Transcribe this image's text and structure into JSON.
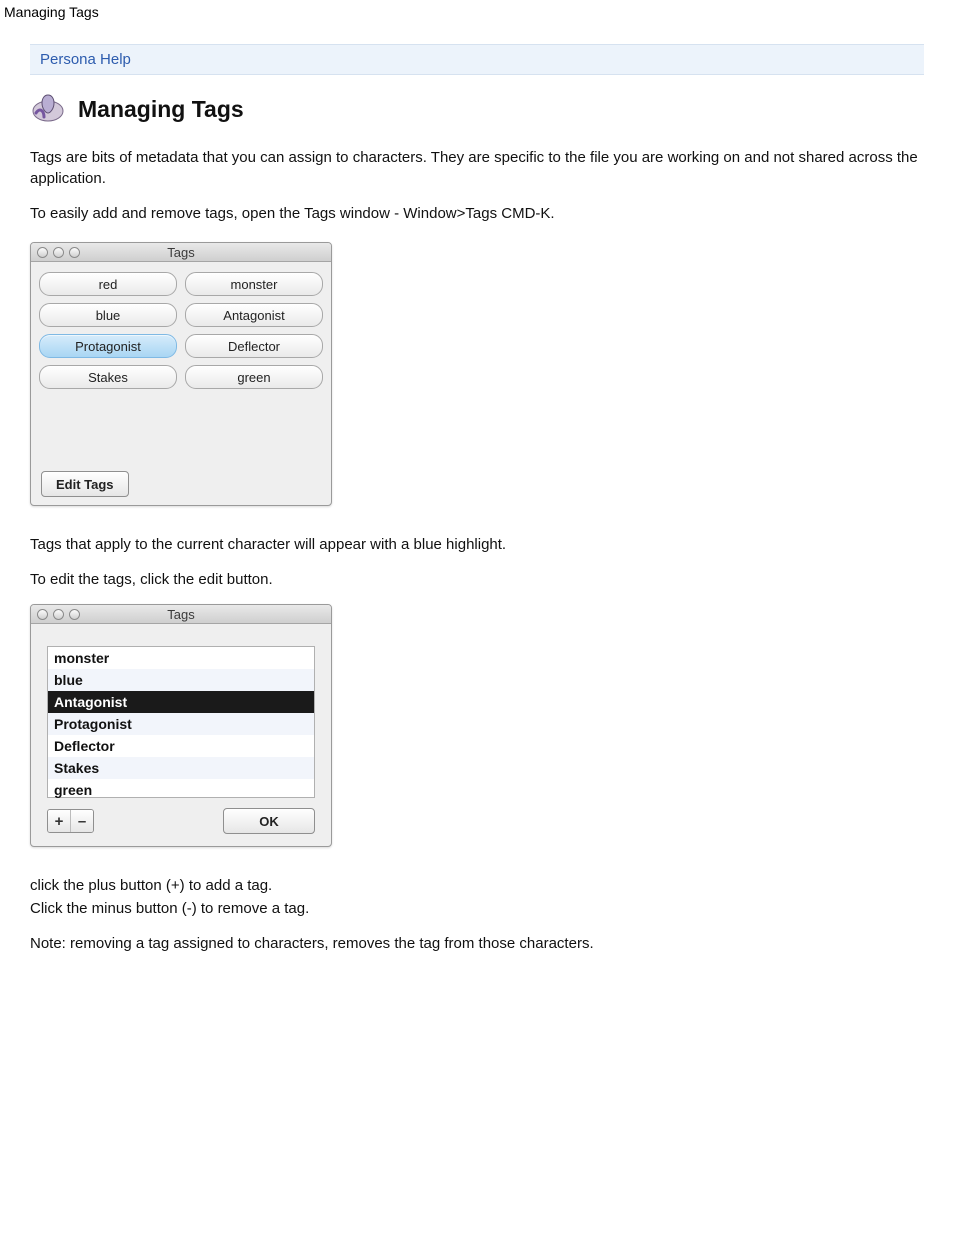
{
  "pageLabel": "Managing Tags",
  "breadcrumb": {
    "label": "Persona Help"
  },
  "title": "Managing Tags",
  "paragraphs": {
    "p1": "Tags are bits of metadata that you can assign to characters. They are specific to the file you are working on and not shared across the application.",
    "p2": "To easily add and remove tags, open the Tags window - Window>Tags CMD-K.",
    "p3": "Tags that apply to the current character will appear with a blue highlight.",
    "p4": "To edit the tags, click the edit button.",
    "p5": "click the plus button (+) to add a tag.",
    "p6": "Click the minus button (-) to remove a tag.",
    "p7": "Note: removing a tag assigned to characters, removes the tag from those characters."
  },
  "tagsWindow": {
    "title": "Tags",
    "pills": [
      {
        "label": "red",
        "selected": false
      },
      {
        "label": "monster",
        "selected": false
      },
      {
        "label": "blue",
        "selected": false
      },
      {
        "label": "Antagonist",
        "selected": false
      },
      {
        "label": "Protagonist",
        "selected": true
      },
      {
        "label": "Deflector",
        "selected": false
      },
      {
        "label": "Stakes",
        "selected": false
      },
      {
        "label": "green",
        "selected": false
      }
    ],
    "editBtn": "Edit Tags"
  },
  "editWindow": {
    "title": "Tags",
    "rows": [
      {
        "label": "monster",
        "alt": false,
        "sel": false
      },
      {
        "label": "blue",
        "alt": true,
        "sel": false
      },
      {
        "label": "Antagonist",
        "alt": false,
        "sel": true
      },
      {
        "label": "Protagonist",
        "alt": true,
        "sel": false
      },
      {
        "label": "Deflector",
        "alt": false,
        "sel": false
      },
      {
        "label": "Stakes",
        "alt": true,
        "sel": false
      },
      {
        "label": "green",
        "alt": false,
        "sel": false
      }
    ],
    "plus": "+",
    "minus": "–",
    "ok": "OK"
  }
}
